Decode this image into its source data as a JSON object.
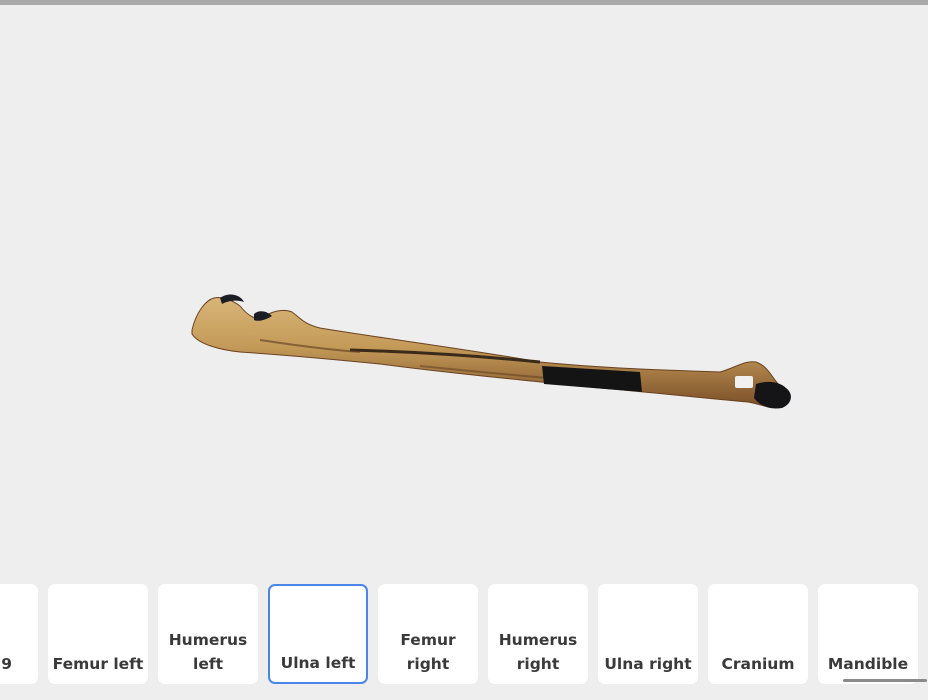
{
  "colors": {
    "background": "#eeeeee",
    "card": "#ffffff",
    "selected_border": "#4a86e8",
    "label": "#3a3a3a"
  },
  "viewer": {
    "model_name": "Ulna left"
  },
  "cards": [
    {
      "label": "9",
      "selected": false
    },
    {
      "label": "Femur left",
      "selected": false
    },
    {
      "label": "Humerus left",
      "selected": false
    },
    {
      "label": "Ulna left",
      "selected": true
    },
    {
      "label": "Femur right",
      "selected": false
    },
    {
      "label": "Humerus right",
      "selected": false
    },
    {
      "label": "Ulna right",
      "selected": false
    },
    {
      "label": "Cranium",
      "selected": false
    },
    {
      "label": "Mandible",
      "selected": false
    }
  ]
}
